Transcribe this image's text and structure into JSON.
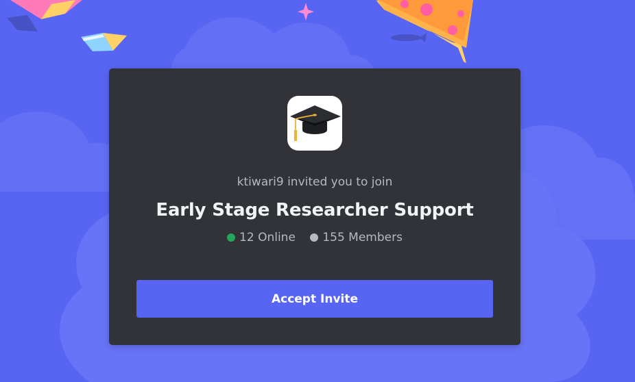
{
  "invite": {
    "inviter_text": "ktiwari9 invited you to join",
    "server_name": "Early Stage Researcher Support",
    "online_text": "12 Online",
    "members_text": "155 Members",
    "accept_label": "Accept Invite",
    "server_icon": "graduation-cap-icon"
  },
  "colors": {
    "background": "#5865f2",
    "card": "#313338",
    "button": "#5865f2",
    "online_dot": "#23a55a",
    "members_dot": "#b5bac1"
  },
  "decorations": [
    "book-icon",
    "book-icon",
    "sparkle-icon",
    "pizza-icon",
    "fish-icon"
  ]
}
